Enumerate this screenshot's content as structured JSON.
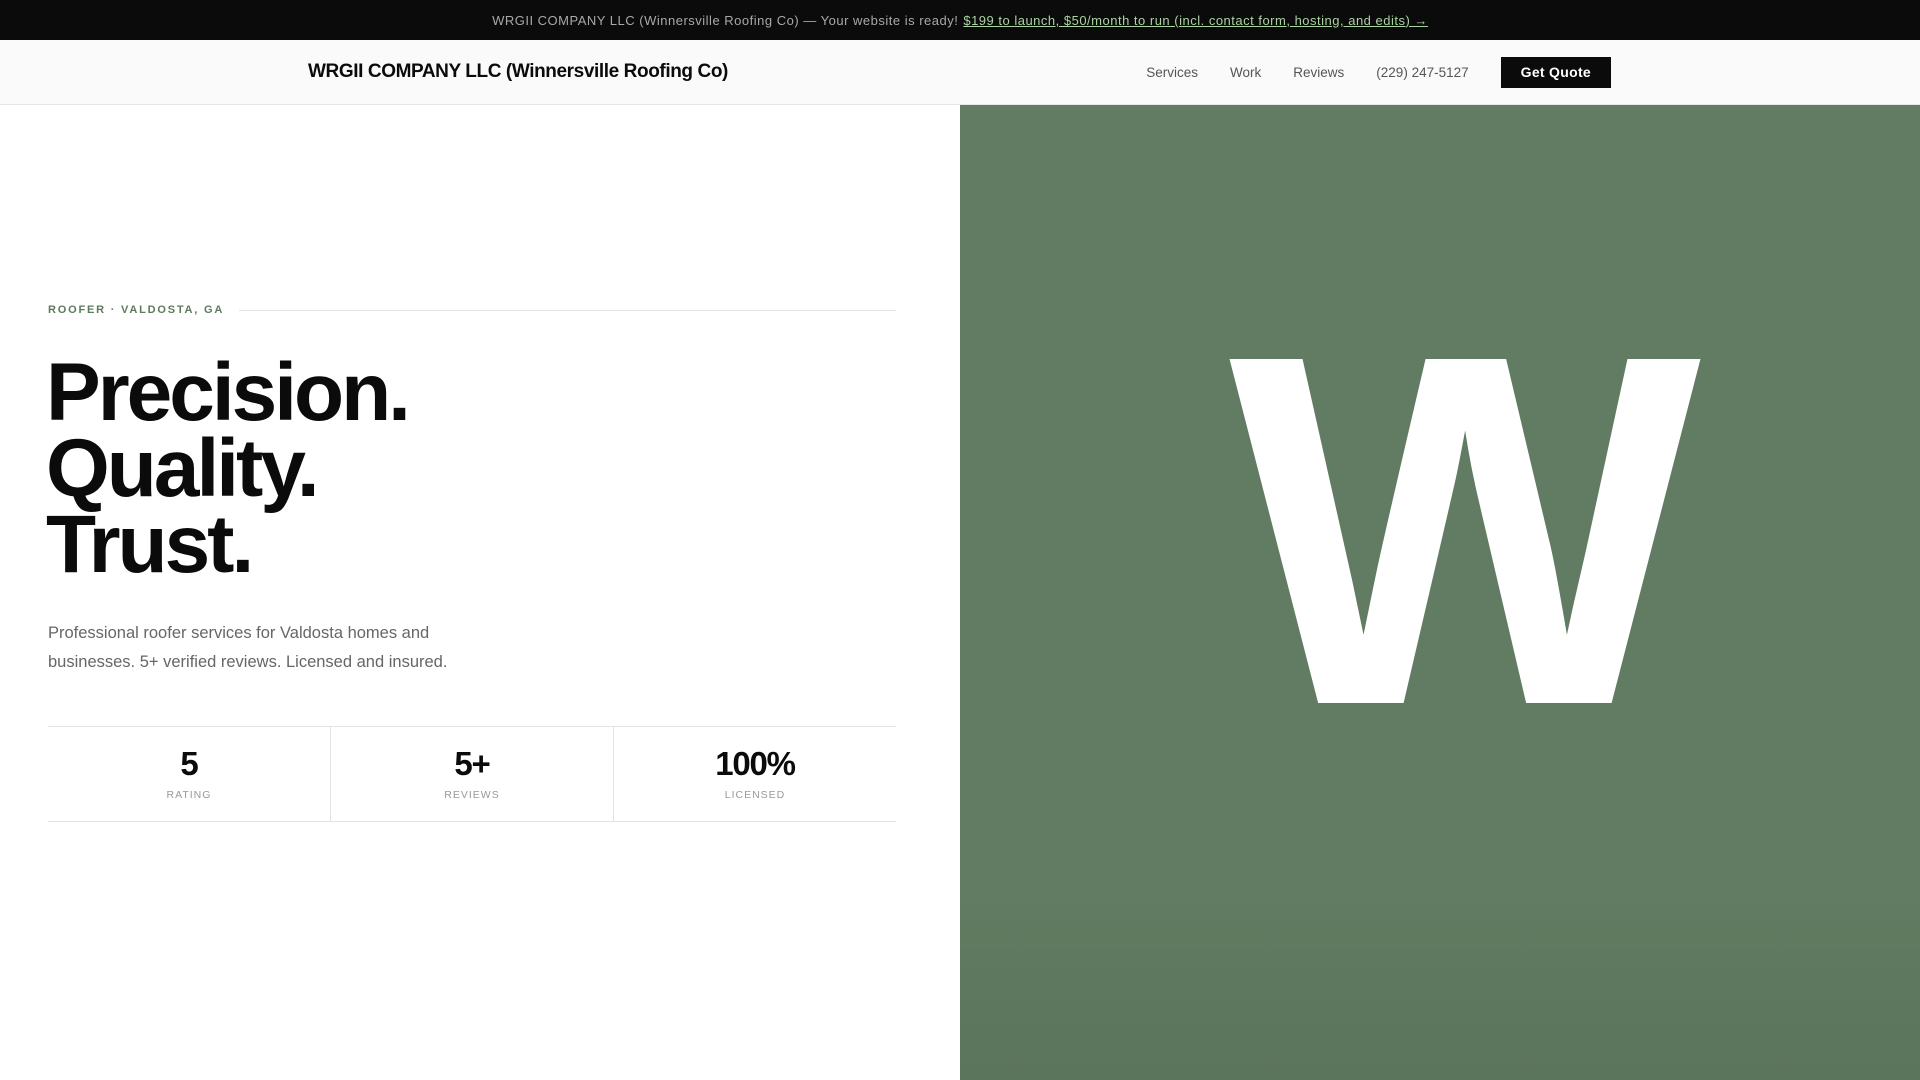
{
  "banner": {
    "text": "WRGII COMPANY LLC (Winnersville Roofing Co) — Your website is ready!",
    "link": "$199 to launch, $50/month to run (incl. contact form, hosting, and edits) →"
  },
  "nav": {
    "brand": "WRGII COMPANY LLC (Winnersville Roofing Co)",
    "links": [
      "Services",
      "Work",
      "Reviews"
    ],
    "phone": "(229) 247-5127",
    "cta": "Get Quote"
  },
  "hero": {
    "eyebrow": "ROOFER · VALDOSTA, GA",
    "headline": [
      "Precision.",
      "Quality.",
      "Trust."
    ],
    "description": "Professional roofer services for Valdosta homes and businesses. 5+ verified reviews. Licensed and insured.",
    "stats": [
      {
        "value": "5",
        "label": "RATING"
      },
      {
        "value": "5+",
        "label": "REVIEWS"
      },
      {
        "value": "100%",
        "label": "LICENSED"
      }
    ],
    "monogram": "W",
    "panel_color": "#617c62"
  }
}
